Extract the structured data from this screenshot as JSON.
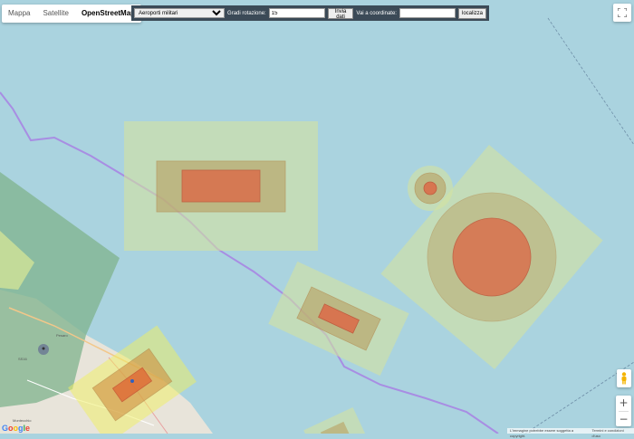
{
  "map_type": {
    "tabs": [
      {
        "label": "Mappa",
        "active": false
      },
      {
        "label": "Satellite",
        "active": false
      },
      {
        "label": "OpenStreetMap",
        "active": true
      }
    ]
  },
  "toolbar": {
    "layer_select_value": "Aeroporti militari",
    "rotation_label": "Gradi rotazione:",
    "rotation_value": "15",
    "send_button": "Invia dati",
    "coords_label": "Vai a coordinate:",
    "coords_value": "",
    "locate_button": "localizza"
  },
  "controls": {
    "fullscreen_icon": "fullscreen-icon",
    "pegman_icon": "pegman-icon",
    "zoom_in": "+",
    "zoom_out": "−"
  },
  "attribution": {
    "logo": "Google",
    "disclaimer": "L'immagine potrebbe essere soggetta a copyright.",
    "terms": "Termini e condizioni d'uso"
  },
  "map_labels": {
    "town": "Pesaro",
    "road": "SS16",
    "place": "Montecchio"
  },
  "colors": {
    "sea": "#aad3df",
    "land": "#e8e4da",
    "outer_zone": "#d4e3a0",
    "middle_zone": "#b9a060",
    "inner_zone": "#e06040",
    "coast_route": "#9b7fd6",
    "green_area": "#8fbd8a"
  }
}
